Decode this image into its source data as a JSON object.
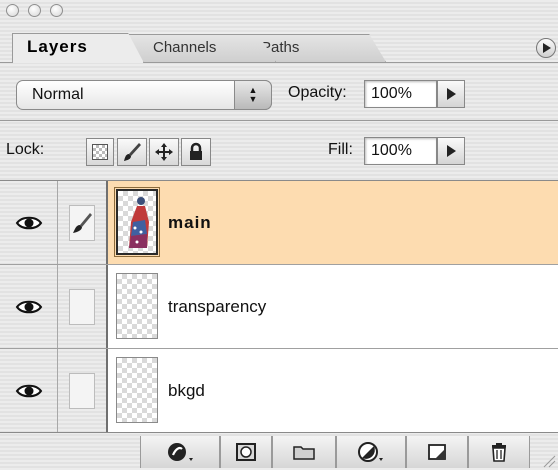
{
  "window": {
    "controls": [
      "close",
      "minimize",
      "zoom"
    ]
  },
  "tabs": [
    {
      "label": "Layers",
      "active": true
    },
    {
      "label": "Channels",
      "active": false
    },
    {
      "label": "Paths",
      "active": false
    }
  ],
  "blend": {
    "mode": "Normal",
    "opacity_label": "Opacity:",
    "opacity_value": "100%"
  },
  "lock": {
    "label": "Lock:",
    "icons": [
      "lock-transparent-pixels-icon",
      "lock-image-pixels-icon",
      "lock-position-icon",
      "lock-all-icon"
    ],
    "fill_label": "Fill:",
    "fill_value": "100%"
  },
  "layers": [
    {
      "name": "main",
      "selected": true,
      "visible": true,
      "brush_linked": true
    },
    {
      "name": "transparency",
      "selected": false,
      "visible": true,
      "brush_linked": false
    },
    {
      "name": "bkgd",
      "selected": false,
      "visible": true,
      "brush_linked": false
    }
  ],
  "toolbar_icons": [
    "layer-style-icon",
    "layer-mask-icon",
    "new-group-icon",
    "adjustment-layer-icon",
    "new-layer-icon",
    "trash-icon"
  ],
  "colors": {
    "selected_row": "#fddcb0",
    "panel_bg": "#ececec"
  }
}
